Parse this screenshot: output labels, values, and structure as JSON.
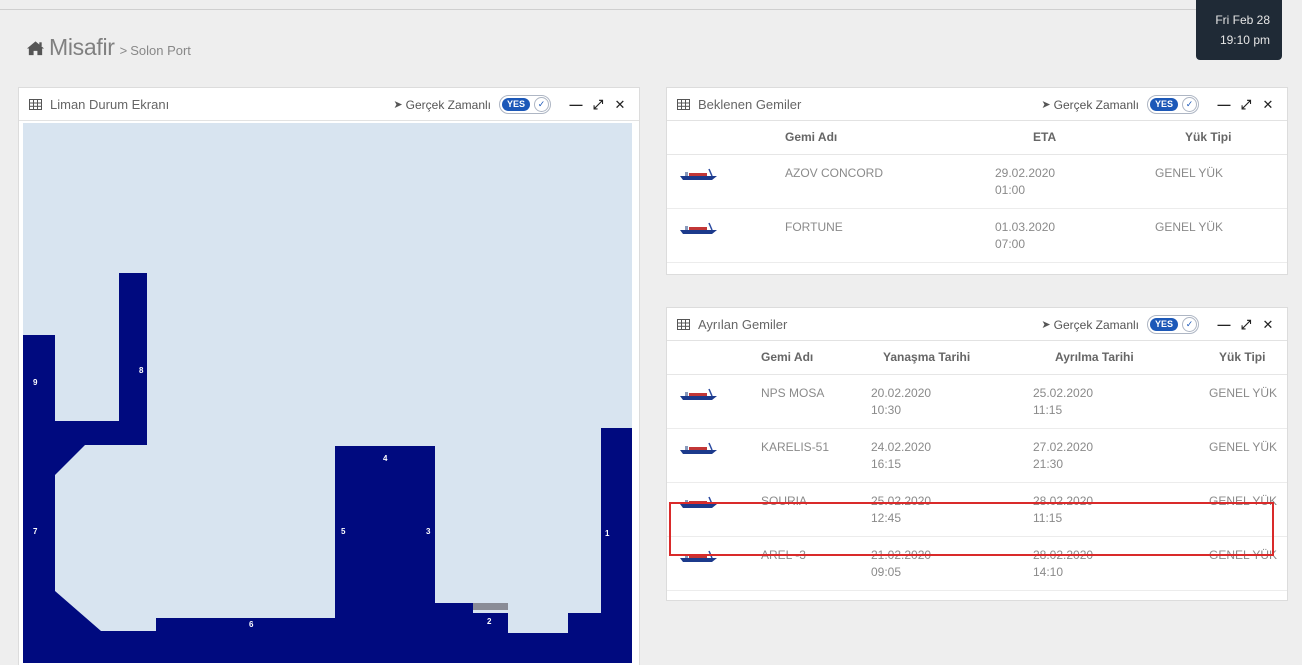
{
  "clock": {
    "line1": "Fri Feb 28",
    "line2": "19:10 pm"
  },
  "breadcrumb": {
    "home_icon": "home-icon",
    "title": "Misafir",
    "separator": ">",
    "page": "Solon Port"
  },
  "realtime": {
    "label": "Gerçek Zamanlı",
    "toggle_text": "YES",
    "toggle_state": "on"
  },
  "colors": {
    "berth_fill": "#000a7f",
    "water": "#d8e4f0",
    "highlight": "#d92a2a",
    "toggle_blue": "#1c58b8",
    "clock_bg": "#1f2a36"
  },
  "map_panel": {
    "title": "Liman Durum Ekranı",
    "berths": [
      "1",
      "2",
      "3",
      "4",
      "5",
      "6",
      "7",
      "8",
      "9"
    ]
  },
  "expected_panel": {
    "title": "Beklenen Gemiler",
    "columns": [
      "Gemi Adı",
      "ETA",
      "Yük Tipi"
    ],
    "rows": [
      {
        "name": "AZOV CONCORD",
        "eta_date": "29.02.2020",
        "eta_time": "01:00",
        "cargo": "GENEL YÜK"
      },
      {
        "name": "FORTUNE",
        "eta_date": "01.03.2020",
        "eta_time": "07:00",
        "cargo": "GENEL YÜK"
      }
    ]
  },
  "departed_panel": {
    "title": "Ayrılan Gemiler",
    "columns": [
      "Gemi Adı",
      "Yanaşma Tarihi",
      "Ayrılma Tarihi",
      "Yük Tipi"
    ],
    "highlighted_row": 2,
    "rows": [
      {
        "name": "NPS MOSA",
        "berth_date": "20.02.2020",
        "berth_time": "10:30",
        "dep_date": "25.02.2020",
        "dep_time": "11:15",
        "cargo": "GENEL YÜK"
      },
      {
        "name": "KARELIS-51",
        "berth_date": "24.02.2020",
        "berth_time": "16:15",
        "dep_date": "27.02.2020",
        "dep_time": "21:30",
        "cargo": "GENEL YÜK"
      },
      {
        "name": "SOURIA",
        "berth_date": "25.02.2020",
        "berth_time": "12:45",
        "dep_date": "28.02.2020",
        "dep_time": "11:15",
        "cargo": "GENEL YÜK"
      },
      {
        "name": "AREL -3",
        "berth_date": "21.02.2020",
        "berth_time": "09:05",
        "dep_date": "28.02.2020",
        "dep_time": "14:10",
        "cargo": "GENEL YÜK"
      }
    ]
  }
}
